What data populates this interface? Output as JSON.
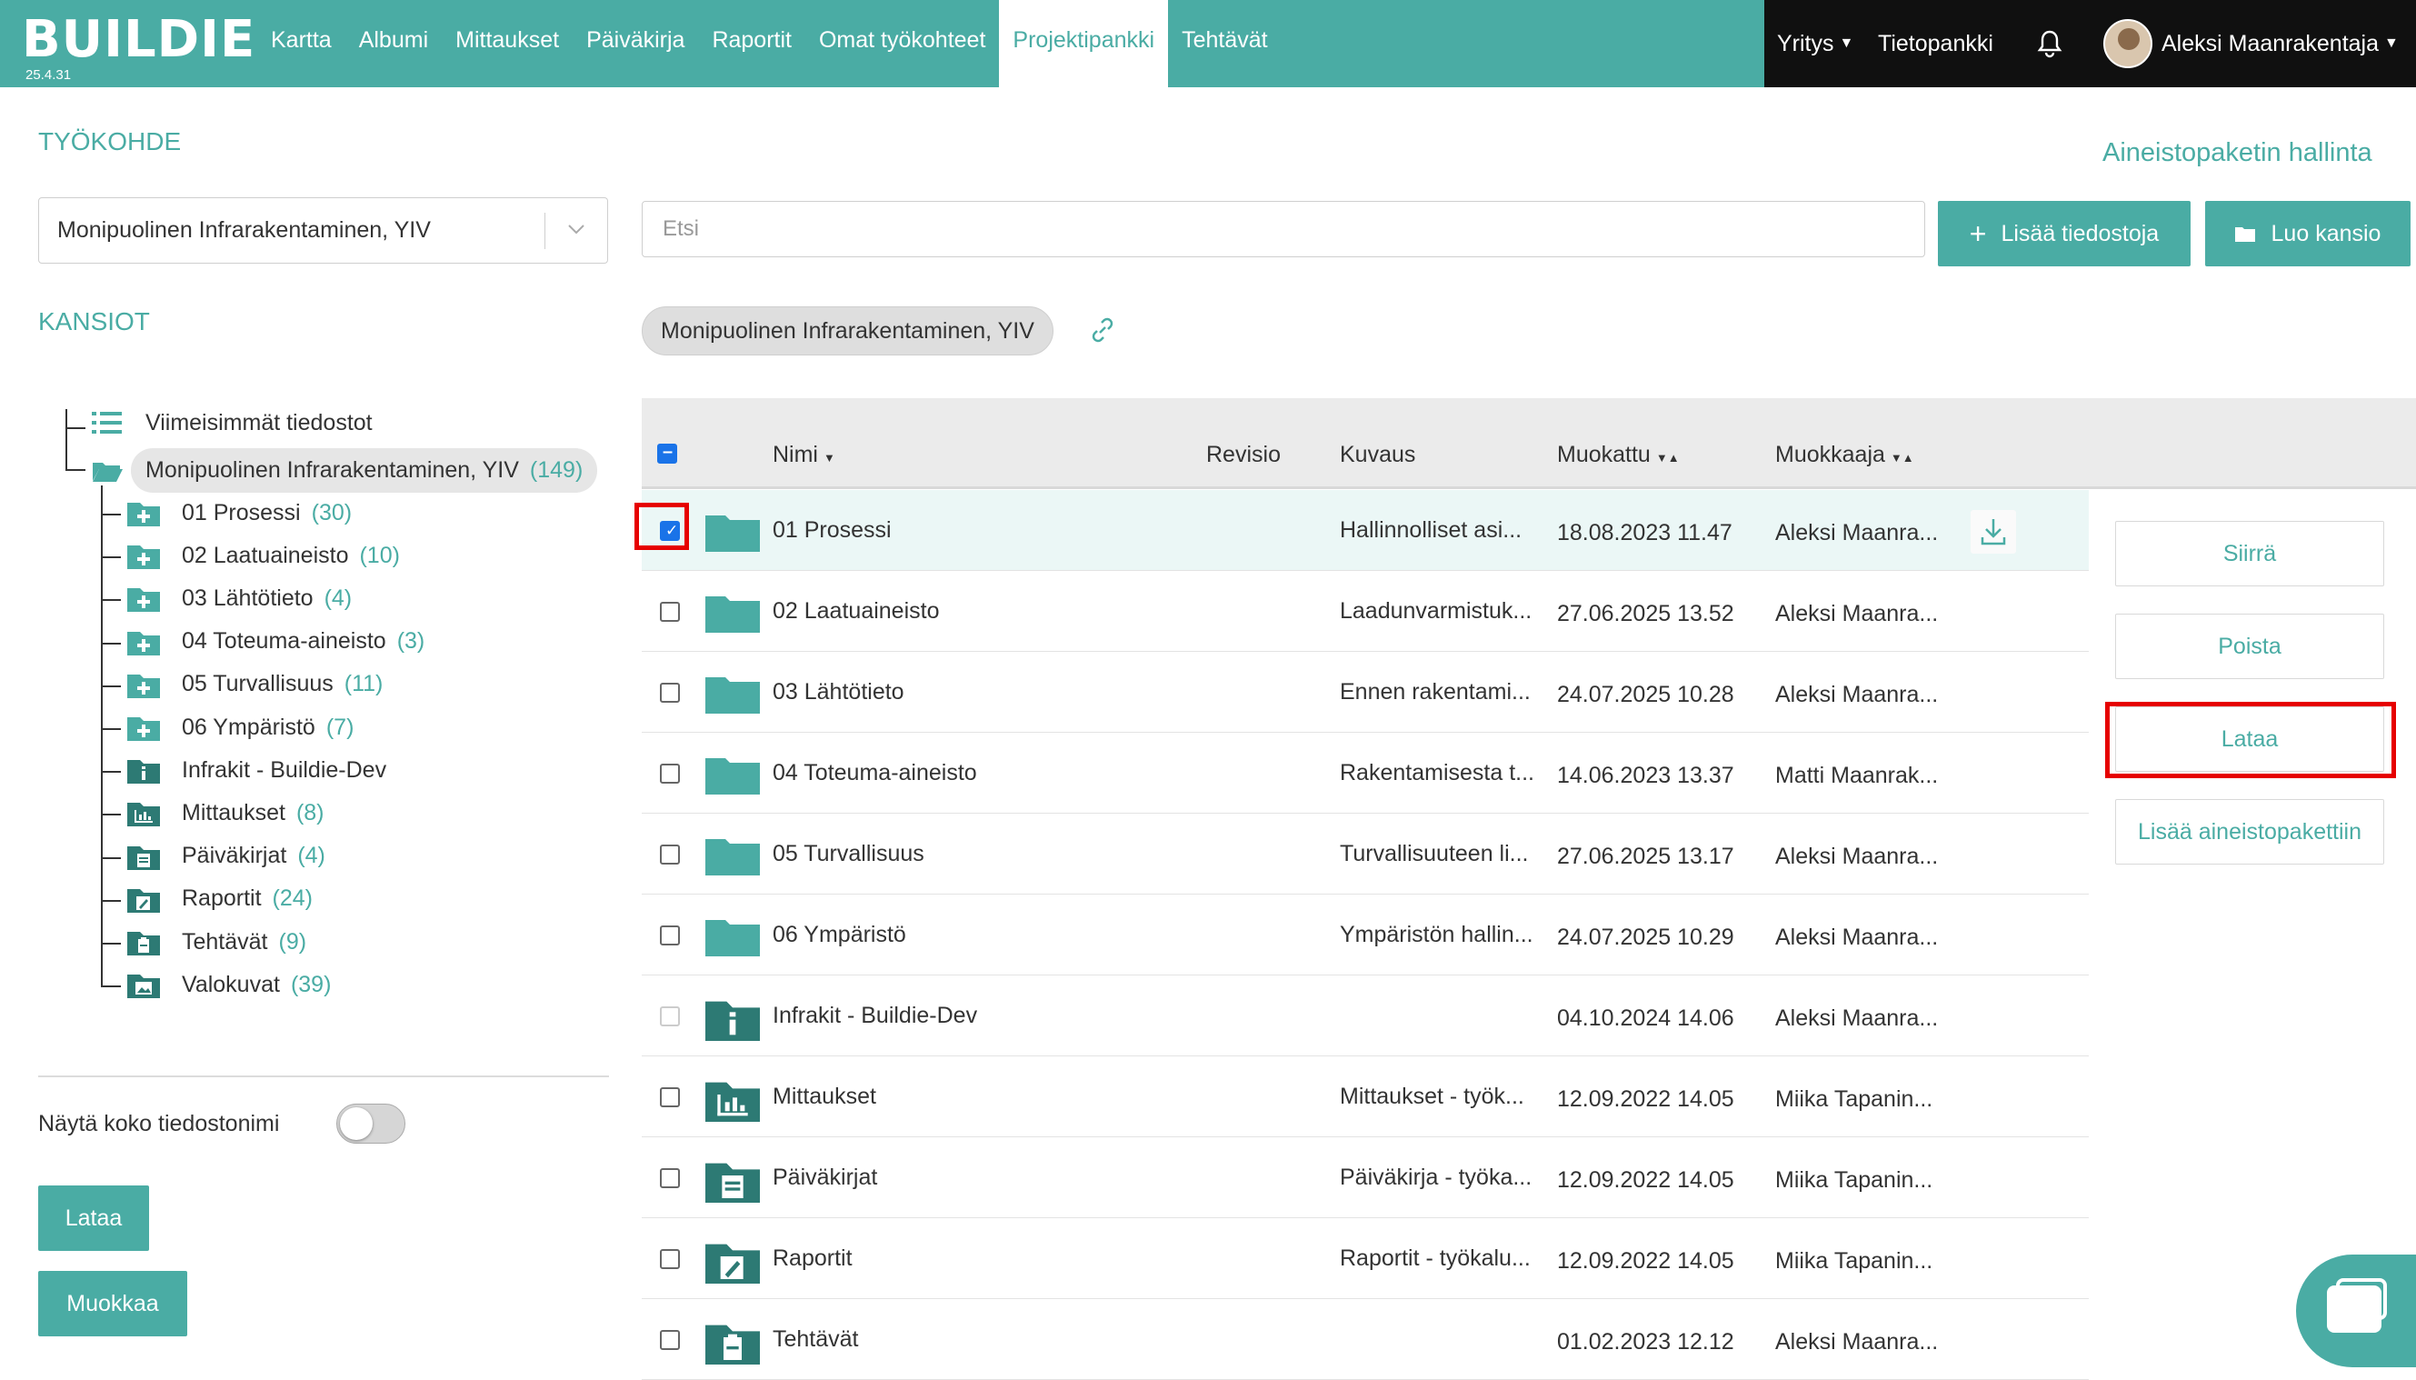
{
  "app": {
    "logo": "BUILDIE",
    "version": "25.4.31",
    "accent_color": "#4aaca4"
  },
  "nav": {
    "items": [
      {
        "label": "Kartta"
      },
      {
        "label": "Albumi"
      },
      {
        "label": "Mittaukset"
      },
      {
        "label": "Päiväkirja"
      },
      {
        "label": "Raportit"
      },
      {
        "label": "Omat työkohteet"
      },
      {
        "label": "Projektipankki",
        "active": true
      },
      {
        "label": "Tehtävät"
      }
    ],
    "company": "Yritys",
    "knowledge_bank": "Tietopankki",
    "user_name": "Aleksi Maanrakentaja",
    "bell_icon": "bell-icon"
  },
  "sidebar": {
    "worksite_title": "TYÖKOHDE",
    "worksite_value": "Monipuolinen Infrarakentaminen, YIV",
    "folders_title": "KANSIOT",
    "recent": "Viimeisimmät tiedostot",
    "root": {
      "label": "Monipuolinen Infrarakentaminen, YIV",
      "count": "(149)"
    },
    "children": [
      {
        "label": "01 Prosessi",
        "count": "(30)",
        "icon": "folder-plus-icon"
      },
      {
        "label": "02 Laatuaineisto",
        "count": "(10)",
        "icon": "folder-plus-icon"
      },
      {
        "label": "03 Lähtötieto",
        "count": "(4)",
        "icon": "folder-plus-icon"
      },
      {
        "label": "04 Toteuma-aineisto",
        "count": "(3)",
        "icon": "folder-plus-icon"
      },
      {
        "label": "05 Turvallisuus",
        "count": "(11)",
        "icon": "folder-plus-icon"
      },
      {
        "label": "06 Ympäristö",
        "count": "(7)",
        "icon": "folder-plus-icon"
      },
      {
        "label": "Infrakit - Buildie-Dev",
        "count": "",
        "icon": "info-folder-icon"
      },
      {
        "label": "Mittaukset",
        "count": "(8)",
        "icon": "chart-folder-icon"
      },
      {
        "label": "Päiväkirjat",
        "count": "(4)",
        "icon": "diary-folder-icon"
      },
      {
        "label": "Raportit",
        "count": "(24)",
        "icon": "report-folder-icon"
      },
      {
        "label": "Tehtävät",
        "count": "(9)",
        "icon": "task-folder-icon"
      },
      {
        "label": "Valokuvat",
        "count": "(39)",
        "icon": "photo-folder-icon"
      }
    ],
    "toggle_label": "Näytä koko tiedostonimi",
    "toggle_on": false,
    "download_button": "Lataa",
    "edit_button": "Muokkaa"
  },
  "main": {
    "search_placeholder": "Etsi",
    "add_files_button": "Lisää tiedostoja",
    "create_folder_button": "Luo kansio",
    "package_management_link": "Aineistopaketin hallinta",
    "breadcrumb": "Monipuolinen Infrarakentaminen, YIV",
    "columns": {
      "name": "Nimi",
      "revision": "Revisio",
      "description": "Kuvaus",
      "modified": "Muokattu",
      "modifier": "Muokkaaja"
    },
    "rows": [
      {
        "name": "01 Prosessi",
        "desc": "Hallinnolliset asi...",
        "modified": "18.08.2023 11.47",
        "modifier": "Aleksi Maanra...",
        "icon": "folder-icon",
        "checked": true,
        "selected": true
      },
      {
        "name": "02 Laatuaineisto",
        "desc": "Laadunvarmistuk...",
        "modified": "27.06.2025 13.52",
        "modifier": "Aleksi Maanra...",
        "icon": "folder-icon",
        "checked": false
      },
      {
        "name": "03 Lähtötieto",
        "desc": "Ennen rakentami...",
        "modified": "24.07.2025 10.28",
        "modifier": "Aleksi Maanra...",
        "icon": "folder-icon",
        "checked": false
      },
      {
        "name": "04 Toteuma-aineisto",
        "desc": "Rakentamisesta t...",
        "modified": "14.06.2023 13.37",
        "modifier": "Matti Maanrak...",
        "icon": "folder-icon",
        "checked": false
      },
      {
        "name": "05 Turvallisuus",
        "desc": "Turvallisuuteen li...",
        "modified": "27.06.2025 13.17",
        "modifier": "Aleksi Maanra...",
        "icon": "folder-icon",
        "checked": false
      },
      {
        "name": "06 Ympäristö",
        "desc": "Ympäristön hallin...",
        "modified": "24.07.2025 10.29",
        "modifier": "Aleksi Maanra...",
        "icon": "folder-icon",
        "checked": false
      },
      {
        "name": "Infrakit - Buildie-Dev",
        "desc": "",
        "modified": "04.10.2024 14.06",
        "modifier": "Aleksi Maanra...",
        "icon": "info-folder-icon",
        "checked": false,
        "disabled": true
      },
      {
        "name": "Mittaukset",
        "desc": "Mittaukset - työk...",
        "modified": "12.09.2022 14.05",
        "modifier": "Miika Tapanin...",
        "icon": "chart-folder-icon",
        "checked": false
      },
      {
        "name": "Päiväkirjat",
        "desc": "Päiväkirja - työka...",
        "modified": "12.09.2022 14.05",
        "modifier": "Miika Tapanin...",
        "icon": "diary-folder-icon",
        "checked": false
      },
      {
        "name": "Raportit",
        "desc": "Raportit - työkalu...",
        "modified": "12.09.2022 14.05",
        "modifier": "Miika Tapanin...",
        "icon": "report-folder-icon",
        "checked": false
      },
      {
        "name": "Tehtävät",
        "desc": "",
        "modified": "01.02.2023 12.12",
        "modifier": "Aleksi Maanra...",
        "icon": "task-folder-icon",
        "checked": false
      }
    ],
    "actions": {
      "move": "Siirrä",
      "delete": "Poista",
      "download": "Lataa",
      "add_to_package": "Lisää aineistopakettiin"
    }
  }
}
